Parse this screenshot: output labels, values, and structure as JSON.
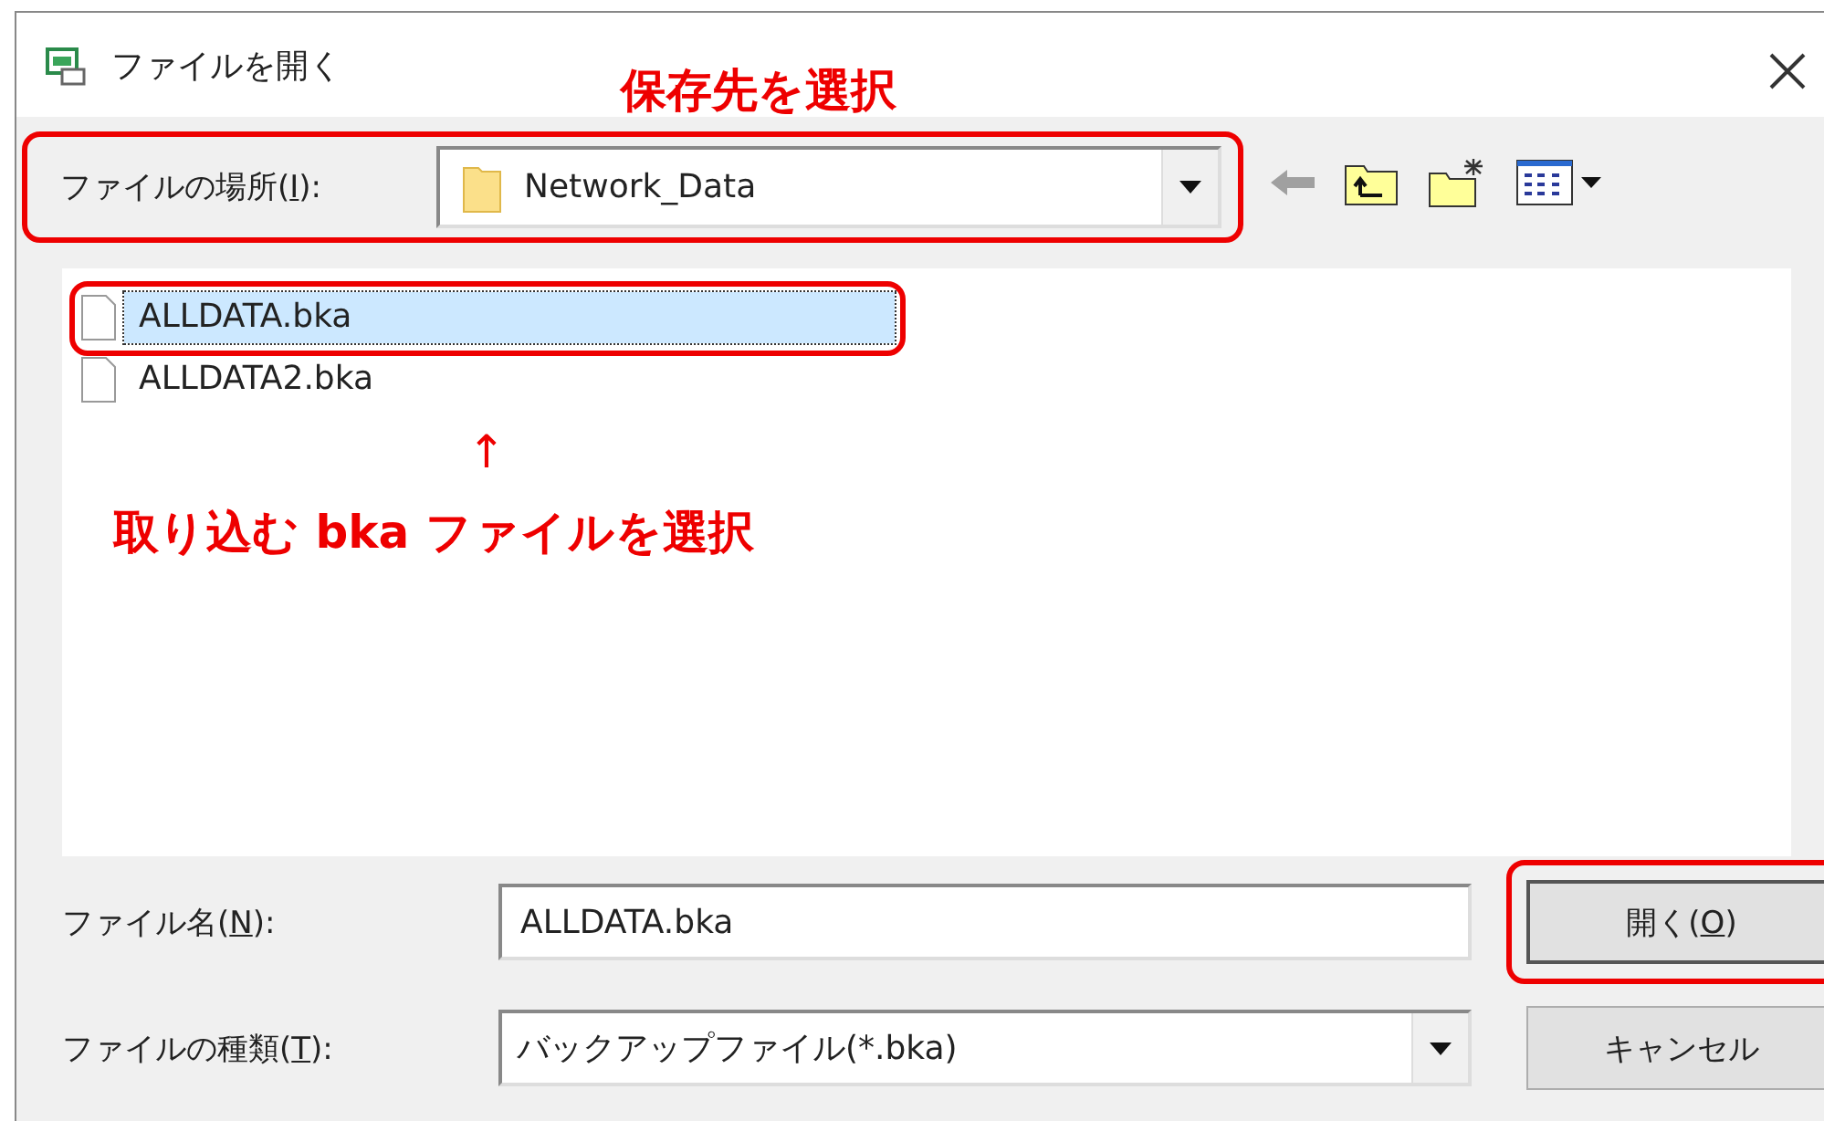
{
  "window": {
    "title": "ファイルを開く"
  },
  "location": {
    "label": {
      "before": "ファイルの場所(",
      "key": "I",
      "after": "):"
    },
    "value": "Network_Data",
    "highlighted": true,
    "note": "保存先を選択"
  },
  "files": [
    {
      "name": "ALLDATA.bka",
      "selected": true,
      "highlighted": true
    },
    {
      "name": "ALLDATA2.bka",
      "selected": false,
      "highlighted": false
    }
  ],
  "file_note": {
    "arrow": "↑",
    "text": "取り込む bka ファイルを選択"
  },
  "file_name": {
    "label": {
      "before": "ファイル名(",
      "key": "N",
      "after": "):"
    },
    "value": "ALLDATA.bka"
  },
  "file_type": {
    "label": {
      "before": "ファイルの種類(",
      "key": "T",
      "after": "):"
    },
    "value": "バックアップファイル(*.bka)"
  },
  "buttons": [
    {
      "label": {
        "before": "開く(",
        "key": "O",
        "after": ")"
      },
      "highlighted": true
    },
    {
      "label": {
        "before": "キャンセル"
      },
      "highlighted": false
    }
  ]
}
